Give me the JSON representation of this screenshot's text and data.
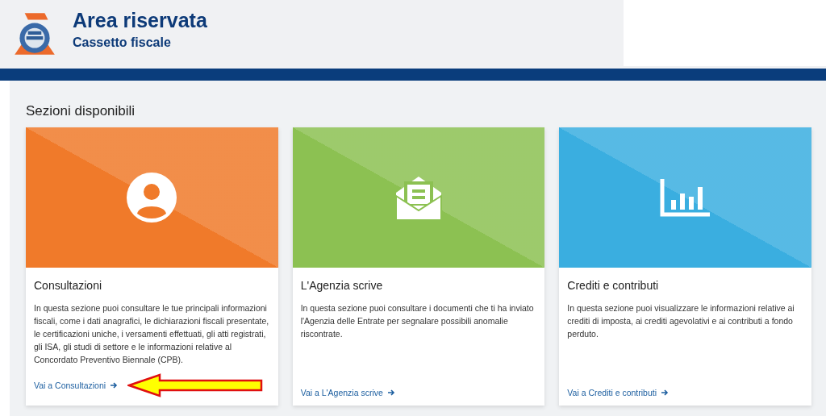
{
  "header": {
    "title": "Area riservata",
    "subtitle": "Cassetto fiscale"
  },
  "section_title": "Sezioni disponibili",
  "cards": [
    {
      "kind": "person",
      "color": "#f07a2a",
      "title": "Consultazioni",
      "text": "In questa sezione puoi consultare le tue principali informazioni fiscali, come i dati anagrafici, le dichiarazioni fiscali presentate, le certificazioni uniche, i versamenti effettuati, gli atti registrati, gli ISA, gli studi di settore e le informazioni relative al Concordato Preventivo Biennale (CPB).",
      "link": "Vai a Consultazioni",
      "highlighted": true
    },
    {
      "kind": "envelope",
      "color": "#8cc152",
      "title": "L'Agenzia scrive",
      "text": "In questa sezione puoi consultare i documenti che ti ha inviato l'Agenzia delle Entrate per segnalare possibili anomalie riscontrate.",
      "link": "Vai a L'Agenzia scrive",
      "highlighted": false
    },
    {
      "kind": "chart",
      "color": "#3aaee0",
      "title": "Crediti e contributi",
      "text": "In questa sezione puoi visualizzare le informazioni relative ai crediti di imposta, ai crediti agevolativi e ai contributi a fondo perduto.",
      "link": "Vai a Crediti e contributi",
      "highlighted": false
    }
  ]
}
